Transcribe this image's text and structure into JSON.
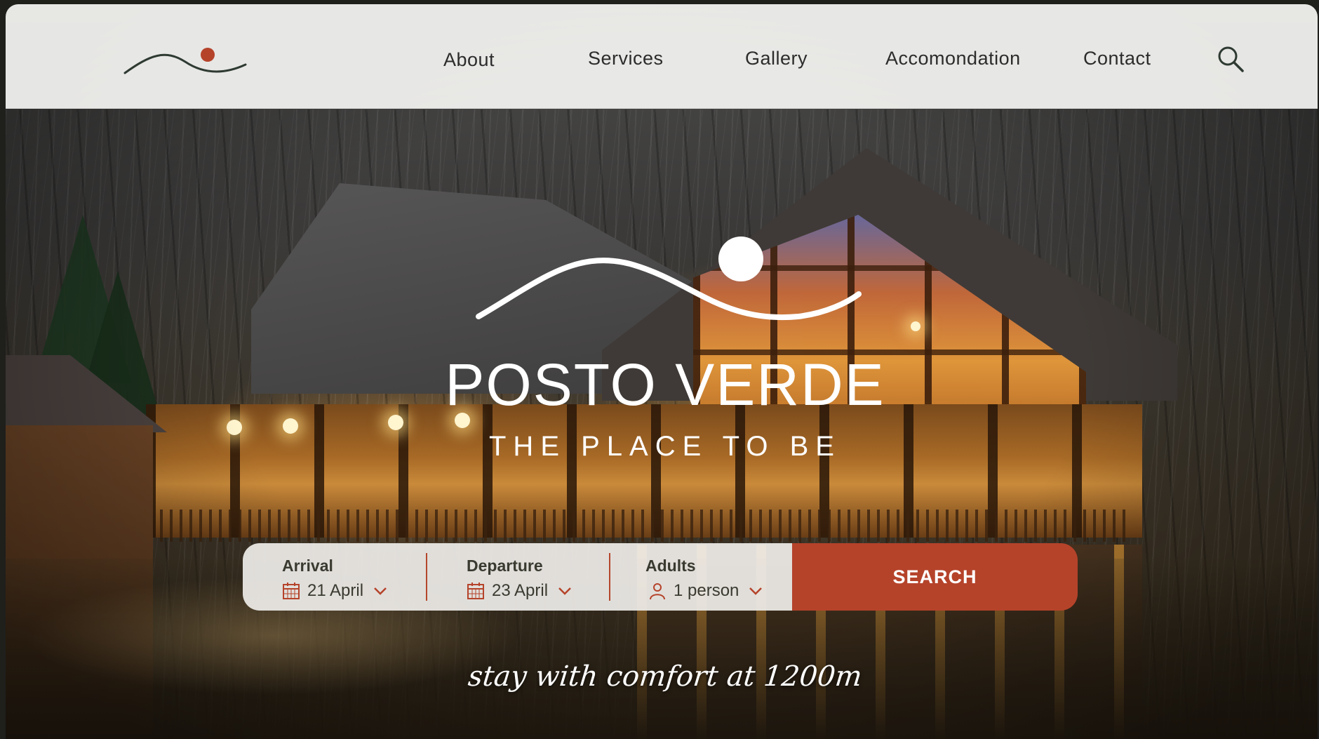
{
  "nav": {
    "items": [
      {
        "label": "About"
      },
      {
        "label": "Services"
      },
      {
        "label": "Gallery"
      },
      {
        "label": "Accomondation"
      },
      {
        "label": "Contact"
      }
    ],
    "search_icon": "search-icon"
  },
  "brand": {
    "name": "POSTO VERDE",
    "subtitle": "THE PLACE TO BE",
    "logo_icon": "mountain-sun-logo"
  },
  "booking": {
    "arrival": {
      "label": "Arrival",
      "value": "21 April",
      "icon": "calendar-icon"
    },
    "departure": {
      "label": "Departure",
      "value": "23 April",
      "icon": "calendar-icon"
    },
    "adults": {
      "label": "Adults",
      "value": "1 person",
      "icon": "person-icon"
    },
    "search_label": "SEARCH"
  },
  "tagline": "stay with comfort at 1200m",
  "colors": {
    "accent": "#b5432a",
    "header_bg": "#f2f2f0",
    "text_dark": "#2c2c2c",
    "white": "#ffffff"
  }
}
